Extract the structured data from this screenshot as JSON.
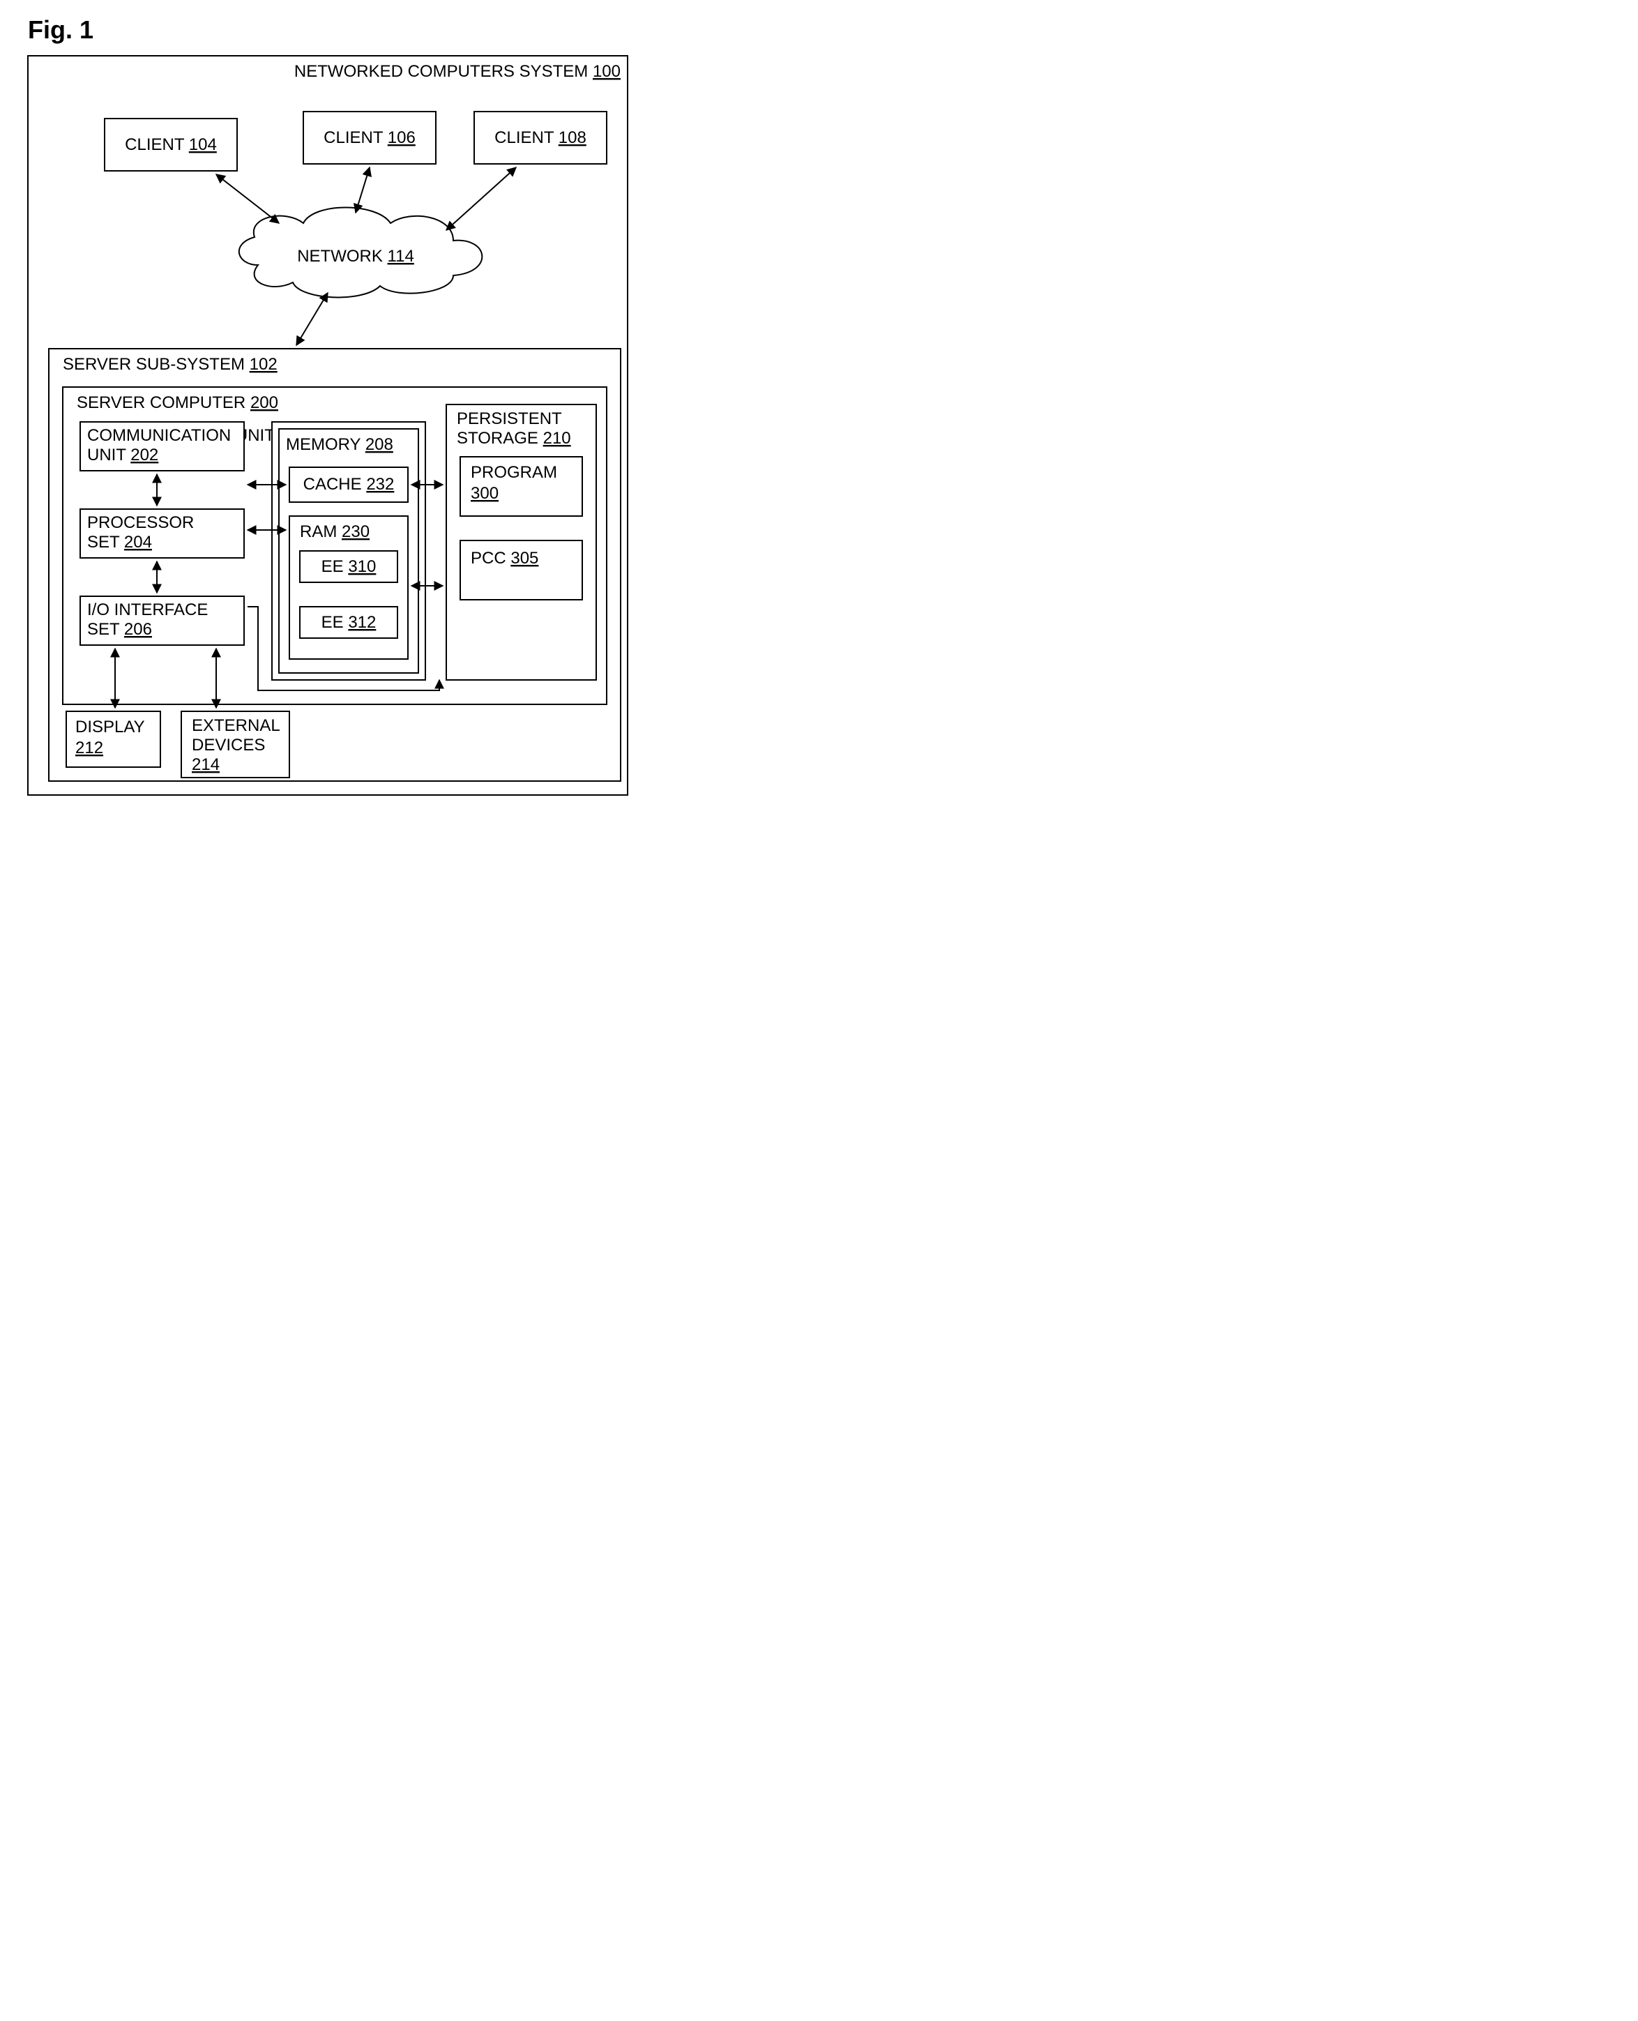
{
  "figureTitle": "Fig. 1",
  "system": {
    "label": "NETWORKED COMPUTERS SYSTEM",
    "ref": "100"
  },
  "clients": [
    {
      "label": "CLIENT",
      "ref": "104"
    },
    {
      "label": "CLIENT",
      "ref": "106"
    },
    {
      "label": "CLIENT",
      "ref": "108"
    }
  ],
  "network": {
    "label": "NETWORK",
    "ref": "114"
  },
  "serverSubsystem": {
    "label": "SERVER SUB-SYSTEM",
    "ref": "102"
  },
  "serverComputer": {
    "label": "SERVER COMPUTER",
    "ref": "200"
  },
  "components": {
    "comm": {
      "label": "COMMUNICATION UNIT",
      "ref": "202"
    },
    "proc": {
      "label": "PROCESSOR SET",
      "ref": "204"
    },
    "io": {
      "label": "I/O INTERFACE SET",
      "ref": "206"
    },
    "memory": {
      "label": "MEMORY",
      "ref": "208"
    },
    "cache": {
      "label": "CACHE",
      "ref": "232"
    },
    "ram": {
      "label": "RAM",
      "ref": "230"
    },
    "ee1": {
      "label": "EE",
      "ref": "310"
    },
    "ee2": {
      "label": "EE",
      "ref": "312"
    },
    "storage": {
      "label": "PERSISTENT STORAGE",
      "ref": "210"
    },
    "program": {
      "label": "PROGRAM",
      "ref": "300"
    },
    "pcc": {
      "label": "PCC",
      "ref": "305"
    },
    "display": {
      "label": "DISPLAY",
      "ref": "212"
    },
    "ext": {
      "label": "EXTERNAL DEVICES",
      "ref": "214"
    }
  }
}
